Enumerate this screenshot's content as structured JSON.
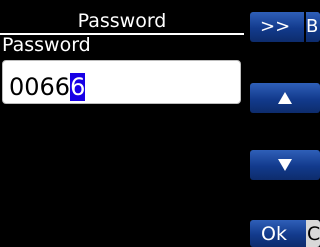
{
  "dialog": {
    "title": "Password",
    "field_label": "Password"
  },
  "input": {
    "value_before_cursor": "0066",
    "cursor_char": "6"
  },
  "buttons": {
    "more_label": ">>",
    "more_peek_label": "B",
    "up_icon": "arrow-up-icon",
    "down_icon": "arrow-down-icon",
    "ok_label": "Ok",
    "next_peek_label": "C"
  },
  "colors": {
    "background": "#000000",
    "button_blue": "#123a8c",
    "cursor_highlight": "#1800e6"
  }
}
